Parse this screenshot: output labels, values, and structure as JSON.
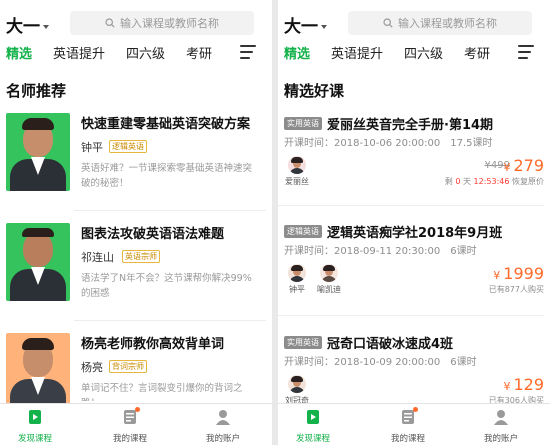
{
  "left_screen": {
    "grade": "大一",
    "search_placeholder": "输入课程或教师名称",
    "tabs": [
      "精选",
      "英语提升",
      "四六级",
      "考研"
    ],
    "section_title": "名师推荐",
    "teachers": [
      {
        "title": "快速重建零基础英语突破方案",
        "name": "钟平",
        "badge": "逻辑英语",
        "desc": "英语好难？一节课探索零基础英语神速突破的秘密！"
      },
      {
        "title": "图表法攻破英语语法难题",
        "name": "祁连山",
        "badge": "英语宗师",
        "desc": "语法学了N年不会？这节课帮你解决99%的困惑"
      },
      {
        "title": "杨亮老师教你高效背单词",
        "name": "杨亮",
        "badge": "背词宗师",
        "desc": "单词记不住？言词裂变引爆你的背词之路！"
      }
    ],
    "nav": [
      "发现课程",
      "我的课程",
      "我的账户"
    ]
  },
  "right_screen": {
    "grade": "大一",
    "search_placeholder": "输入课程或教师名称",
    "tabs": [
      "精选",
      "英语提升",
      "四六级",
      "考研"
    ],
    "section_title": "精选好课",
    "courses": [
      {
        "tag": "实用英语",
        "title": "爱丽丝英音完全手册·第14期",
        "start": "开课时间：2018-10-06 20:00:00",
        "hours": "17.5课时",
        "teachers": [
          "爱丽丝"
        ],
        "old_price": "¥499",
        "currency": "¥",
        "price": "279",
        "sub_prefix": "剩",
        "sub_days": "0",
        "sub_mid": "天",
        "sub_time": "12:53:46",
        "sub_suffix": "恢复原价"
      },
      {
        "tag": "逻辑英语",
        "title": "逻辑英语痴学社2018年9月班",
        "start": "开课时间：2018-09-11 20:30:00",
        "hours": "6课时",
        "teachers": [
          "钟平",
          "喻凯迪"
        ],
        "currency": "¥",
        "price": "1999",
        "sub": "已有877人购买"
      },
      {
        "tag": "实用英语",
        "title": "冠奇口语破冰速成4班",
        "start": "开课时间：2018-10-09 20:00:00",
        "hours": "6课时",
        "teachers": [
          "刘冠奇"
        ],
        "currency": "¥",
        "price": "129",
        "sub": "已有306人购买"
      }
    ],
    "nav": [
      "发现课程",
      "我的课程",
      "我的账户"
    ]
  },
  "colors": {
    "accent": "#14b24a",
    "price": "#ff6a2b",
    "badge": "#e6b640"
  }
}
